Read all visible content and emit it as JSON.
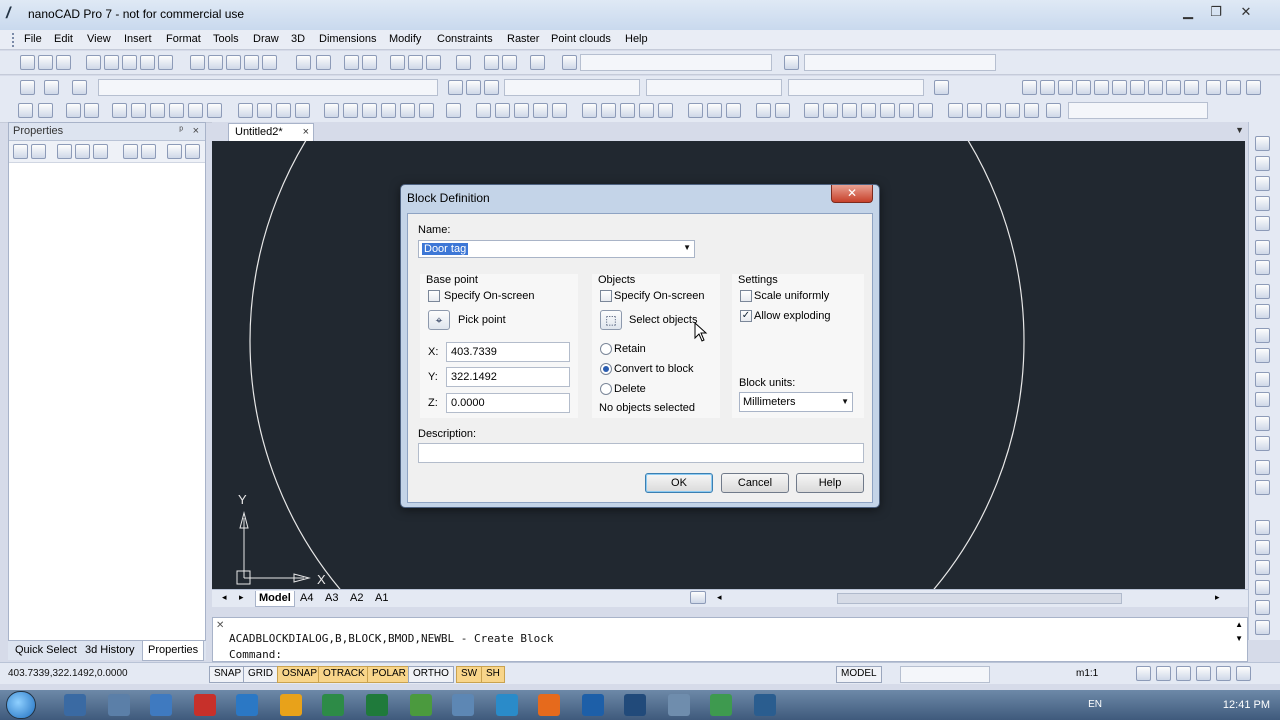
{
  "window": {
    "title": "nanoCAD Pro 7 - not for commercial use",
    "icon": "nanocad-logo-icon"
  },
  "menu": [
    "File",
    "Edit",
    "View",
    "Insert",
    "Format",
    "Tools",
    "Draw",
    "3D",
    "Dimensions",
    "Modify",
    "Constraints",
    "Raster",
    "Point clouds",
    "Help"
  ],
  "properties_panel": {
    "title": "Properties",
    "pin": "ᵖ",
    "close": "×"
  },
  "panel_tabs": [
    "Quick Select",
    "3d History",
    "Properties"
  ],
  "doc_tab": {
    "label": "Untitled2*",
    "close": "×"
  },
  "layout_tabs": [
    "Model",
    "A4",
    "A3",
    "A2",
    "A1"
  ],
  "command": {
    "history": "ACADBLOCKDIALOG,B,BLOCK,BMOD,NEWBL - Create Block",
    "prompt": "Command:"
  },
  "axes": {
    "y": "Y",
    "x": "X"
  },
  "status": {
    "coords": "403.7339,322.1492,0.0000",
    "toggles": [
      {
        "label": "SNAP",
        "on": false
      },
      {
        "label": "GRID",
        "on": false
      },
      {
        "label": "OSNAP",
        "on": true
      },
      {
        "label": "OTRACK",
        "on": true
      },
      {
        "label": "POLAR",
        "on": true
      },
      {
        "label": "ORTHO",
        "on": false
      },
      {
        "label": "SW",
        "on": true
      },
      {
        "label": "SH",
        "on": true
      }
    ],
    "model_label": "MODEL",
    "scale": "m1:1"
  },
  "taskbar": {
    "lang": "EN",
    "time": "12:41 PM"
  },
  "dialog": {
    "title": "Block Definition",
    "close": "✕",
    "name_label": "Name:",
    "name_value": "Door tag",
    "base_point": {
      "heading": "Base point",
      "specify_label": "Specify On-screen",
      "pick_label": "Pick point",
      "x_label": "X:",
      "x_value": "403.7339",
      "y_label": "Y:",
      "y_value": "322.1492",
      "z_label": "Z:",
      "z_value": "0.0000"
    },
    "objects": {
      "heading": "Objects",
      "specify_label": "Specify On-screen",
      "select_label": "Select objects",
      "retain": "Retain",
      "convert": "Convert to block",
      "delete": "Delete",
      "status": "No objects selected"
    },
    "settings": {
      "heading": "Settings",
      "scale_label": "Scale uniformly",
      "explode_label": "Allow exploding",
      "explode_checked": "✓",
      "units_label": "Block units:",
      "units_value": "Millimeters"
    },
    "description_label": "Description:",
    "description_value": "",
    "ok": "OK",
    "cancel": "Cancel",
    "help": "Help"
  }
}
